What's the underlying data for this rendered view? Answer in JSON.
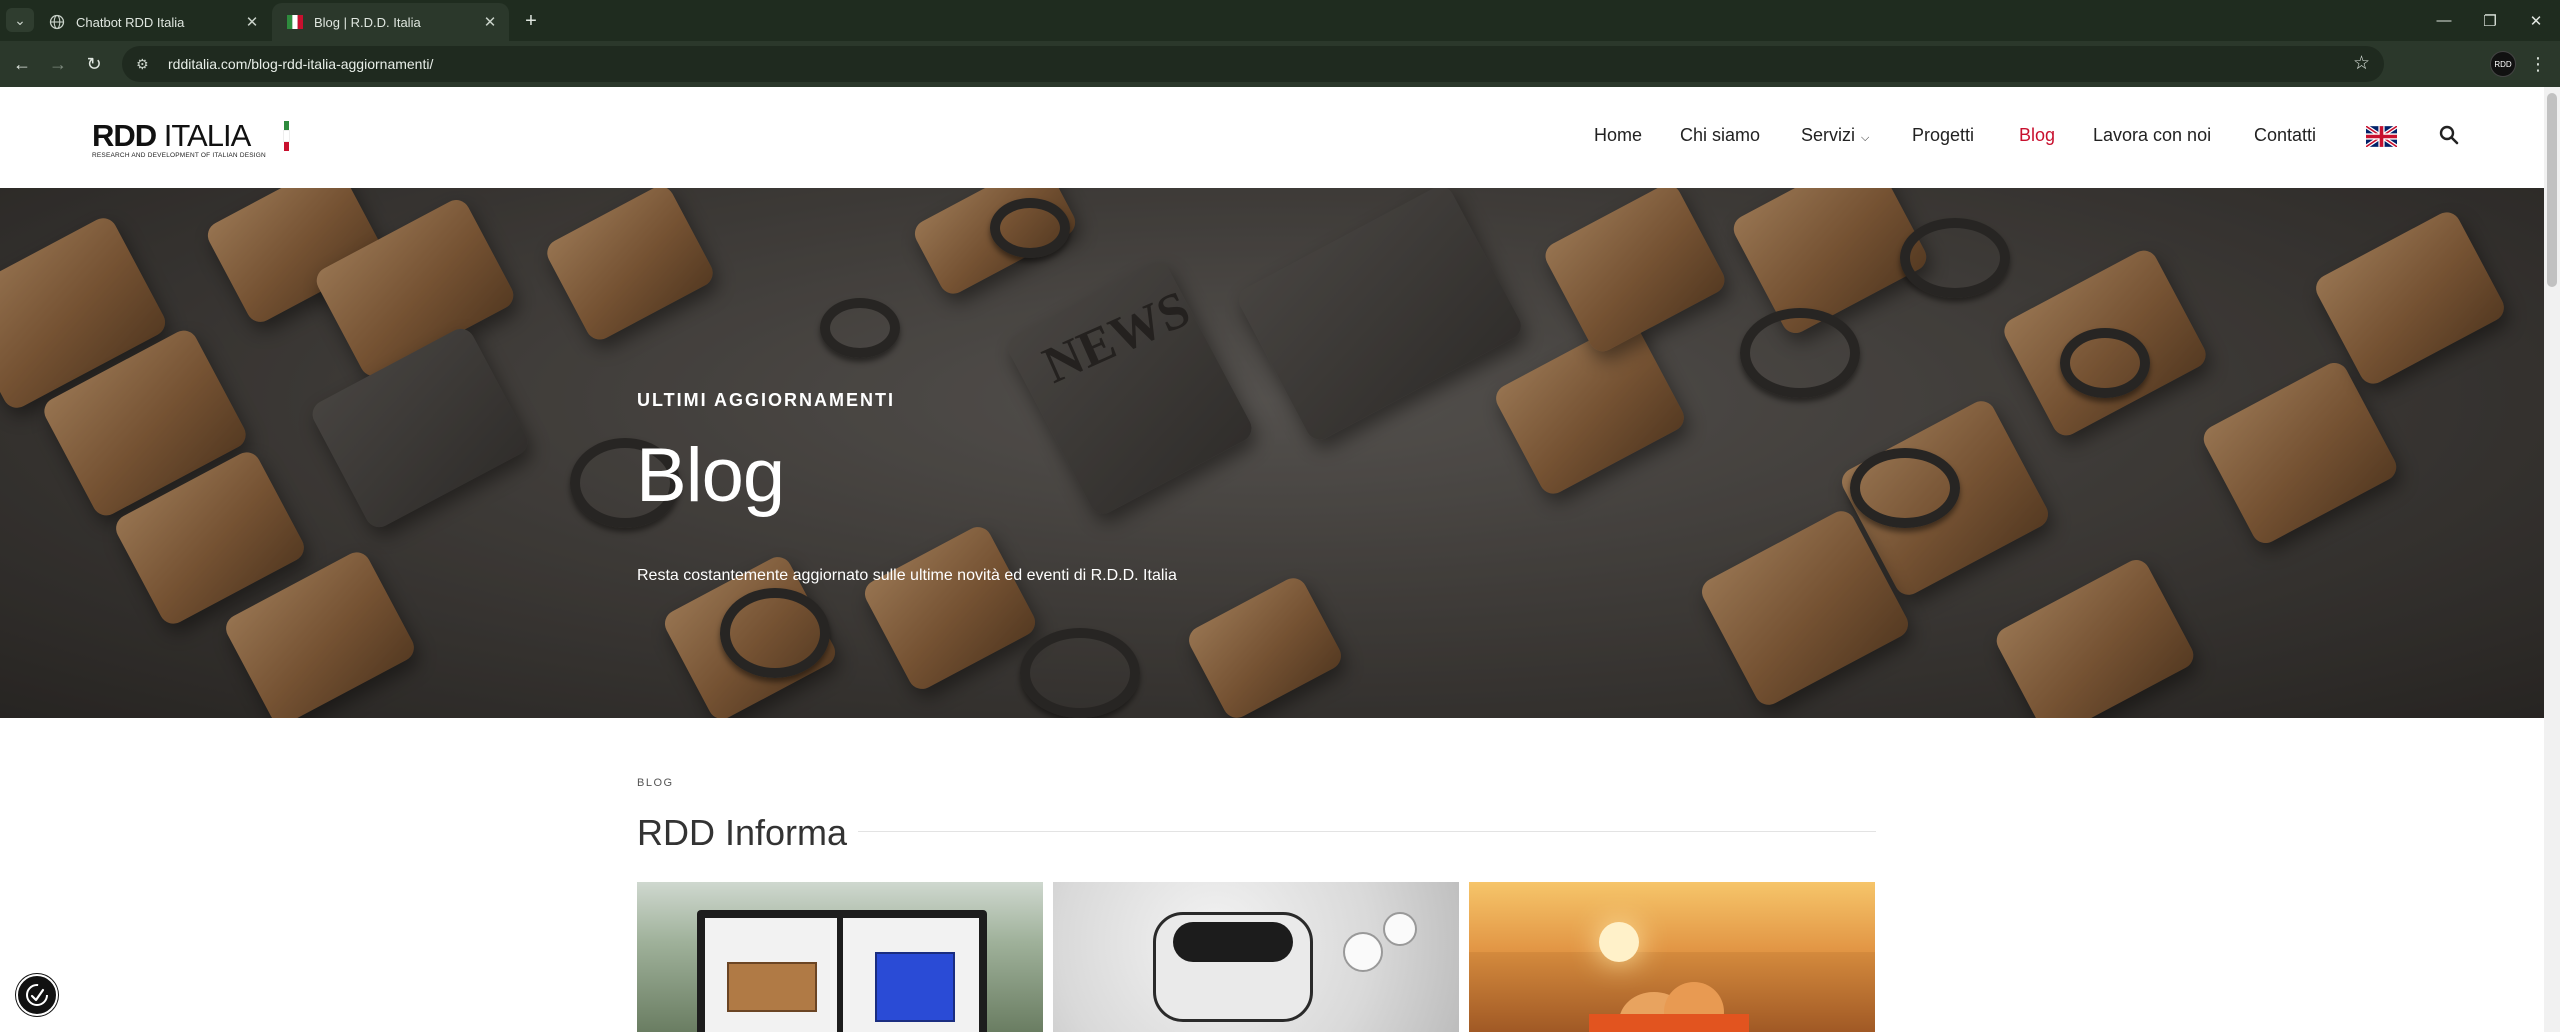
{
  "browser": {
    "tabs": [
      {
        "title": "Chatbot RDD Italia",
        "active": false
      },
      {
        "title": "Blog | R.D.D. Italia",
        "active": true
      }
    ],
    "url": "rdditalia.com/blog-rdd-italia-aggiornamenti/",
    "profile_label": "RDD"
  },
  "site": {
    "logo": {
      "word_bold": "RDD",
      "word_rest": " ITALIA",
      "tagline": "RESEARCH AND DEVELOPMENT OF ITALIAN DESIGN"
    },
    "nav": [
      {
        "label": "Home",
        "active": false
      },
      {
        "label": "Chi siamo",
        "active": false
      },
      {
        "label": "Servizi",
        "active": false,
        "has_dropdown": true
      },
      {
        "label": "Progetti",
        "active": false
      },
      {
        "label": "Blog",
        "active": true
      },
      {
        "label": "Lavora con noi",
        "active": false
      },
      {
        "label": "Contatti",
        "active": false
      }
    ],
    "accent_color": "#c8102e"
  },
  "hero": {
    "eyebrow": "ULTIMI AGGIORNAMENTI",
    "title": "Blog",
    "subtitle": "Resta costantemente aggiornato sulle ultime novità ed eventi di R.D.D. Italia",
    "image_text": "NEWS"
  },
  "section": {
    "eyebrow": "BLOG",
    "title": "RDD Informa"
  }
}
